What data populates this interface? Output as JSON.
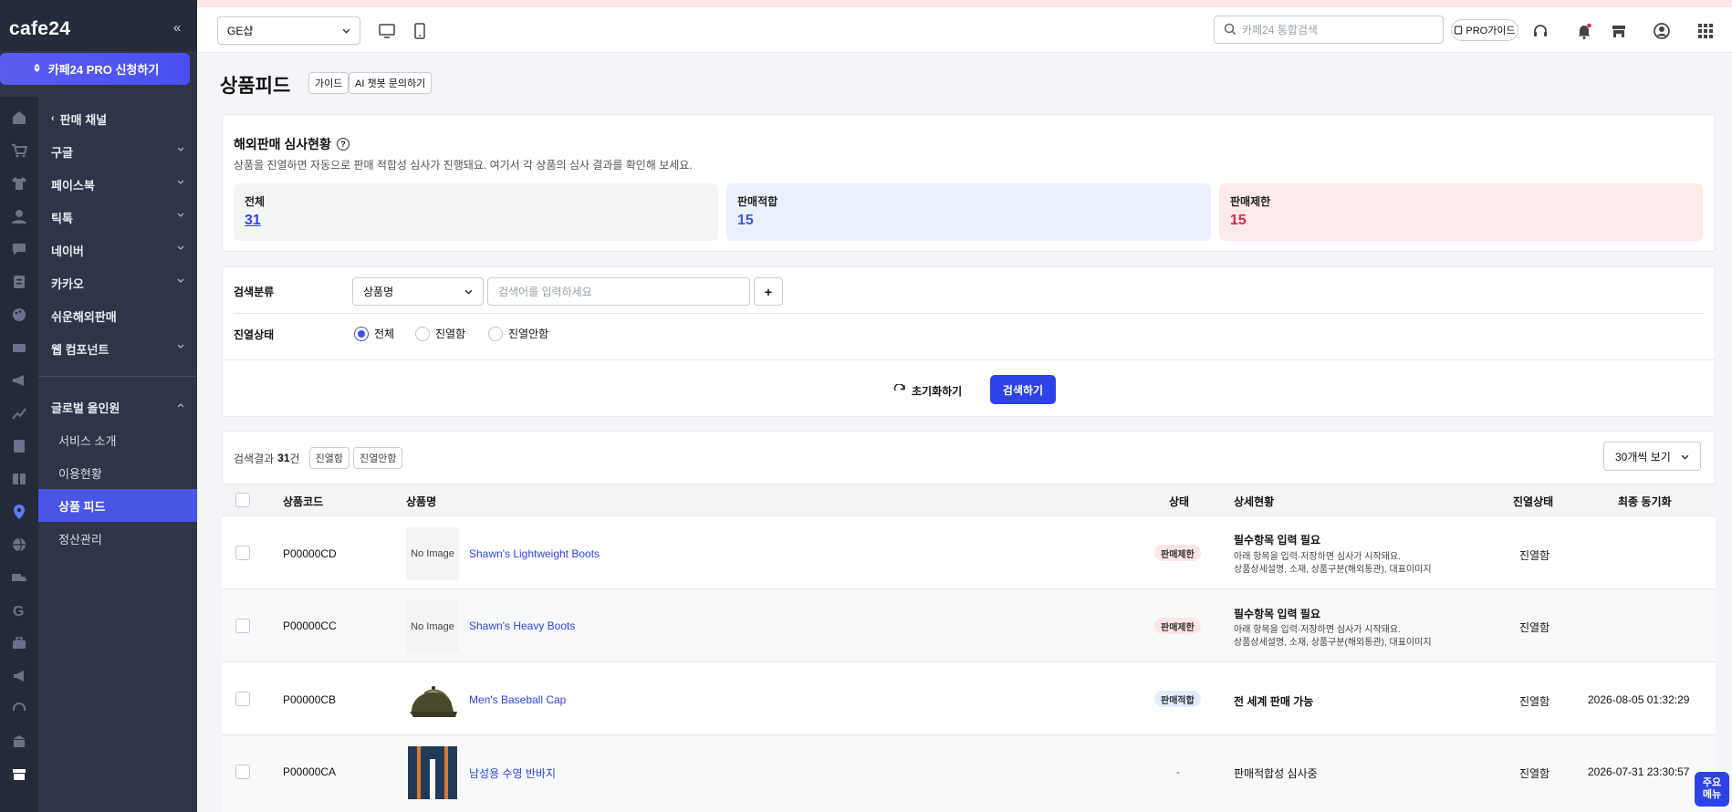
{
  "sidebar": {
    "logo": "cafe24",
    "collapse_icon": "«",
    "pro_button": "카페24 PRO 신청하기",
    "back_label": "판매 채널",
    "menu": [
      {
        "label": "구글"
      },
      {
        "label": "페이스북"
      },
      {
        "label": "틱톡"
      },
      {
        "label": "네이버"
      },
      {
        "label": "카카오"
      },
      {
        "label": "쉬운해외판매"
      },
      {
        "label": "웹 컴포넌트"
      }
    ],
    "group_label": "글로벌 올인원",
    "sub_items": [
      {
        "label": "서비스 소개"
      },
      {
        "label": "이용현황"
      },
      {
        "label": "상품 피드"
      },
      {
        "label": "정산관리"
      }
    ]
  },
  "topbar": {
    "shop_select": "GE샵",
    "search_placeholder": "카페24 통합검색",
    "pro_guide": "PRO가이드"
  },
  "page": {
    "title": "상품피드",
    "guide_chip": "가이드",
    "ai_chip": "AI 챗봇 문의하기"
  },
  "review": {
    "title": "해외판매 심사현황",
    "help": "?",
    "desc": "상품을 진열하면 자동으로 판매 적합성 심사가 진행돼요. 여기서 각 상품의 심사 결과를 확인해 보세요.",
    "stats": [
      {
        "label": "전체",
        "value": "31",
        "color": "#2d43e8"
      },
      {
        "label": "판매적합",
        "value": "15",
        "color": "#3b5bf0"
      },
      {
        "label": "판매제한",
        "value": "15",
        "color": "#e8244a"
      }
    ]
  },
  "search": {
    "category_label": "검색분류",
    "category_value": "상품명",
    "keyword_placeholder": "검색어를 입력하세요",
    "add_label": "+",
    "display_label": "진열상태",
    "radios": [
      {
        "label": "전체",
        "checked": true
      },
      {
        "label": "진열함",
        "checked": false
      },
      {
        "label": "진열안함",
        "checked": false
      }
    ],
    "reset_label": "초기화하기",
    "search_label": "검색하기"
  },
  "results": {
    "prefix": "검색결과",
    "count": "31",
    "suffix": "건",
    "show_btn": "진열함",
    "hide_btn": "진열안함",
    "per_page": "30개씩 보기"
  },
  "table": {
    "headers": {
      "code": "상품코드",
      "name": "상품명",
      "status": "상태",
      "detail": "상세현황",
      "display": "진열상태",
      "sync": "최종 동기화"
    },
    "rows": [
      {
        "code": "P00000CD",
        "image": "No Image",
        "name": "Shawn's Lightweight Boots",
        "status": "판매제한",
        "detail_title": "필수항목 입력 필요",
        "detail_line1": "아래 항목을 입력·저장하면 심사가 시작돼요.",
        "detail_line2": "상품상세설명, 소재, 상품구분(해외통관), 대표이미지",
        "display": "진열함",
        "sync": ""
      },
      {
        "code": "P00000CC",
        "image": "No Image",
        "name": "Shawn's Heavy Boots",
        "status": "판매제한",
        "detail_title": "필수항목 입력 필요",
        "detail_line1": "아래 항목을 입력·저장하면 심사가 시작돼요.",
        "detail_line2": "상품상세설명, 소재, 상품구분(해외통관), 대표이미지",
        "display": "진열함",
        "sync": ""
      },
      {
        "code": "P00000CB",
        "image": "cap",
        "name": "Men's Baseball Cap",
        "status": "판매적합",
        "detail_title": "전 세계 판매 가능",
        "display": "진열함",
        "sync": "2026-08-05 01:32:29"
      },
      {
        "code": "P00000CA",
        "image": "shorts",
        "name": "남성용 수영 반바지",
        "status": "-",
        "detail_title": "판매적합성 심사중",
        "display": "진열함",
        "sync": "2026-07-31 23:30:57"
      }
    ]
  },
  "quick_menu": {
    "line1": "주요",
    "line2": "메뉴"
  }
}
